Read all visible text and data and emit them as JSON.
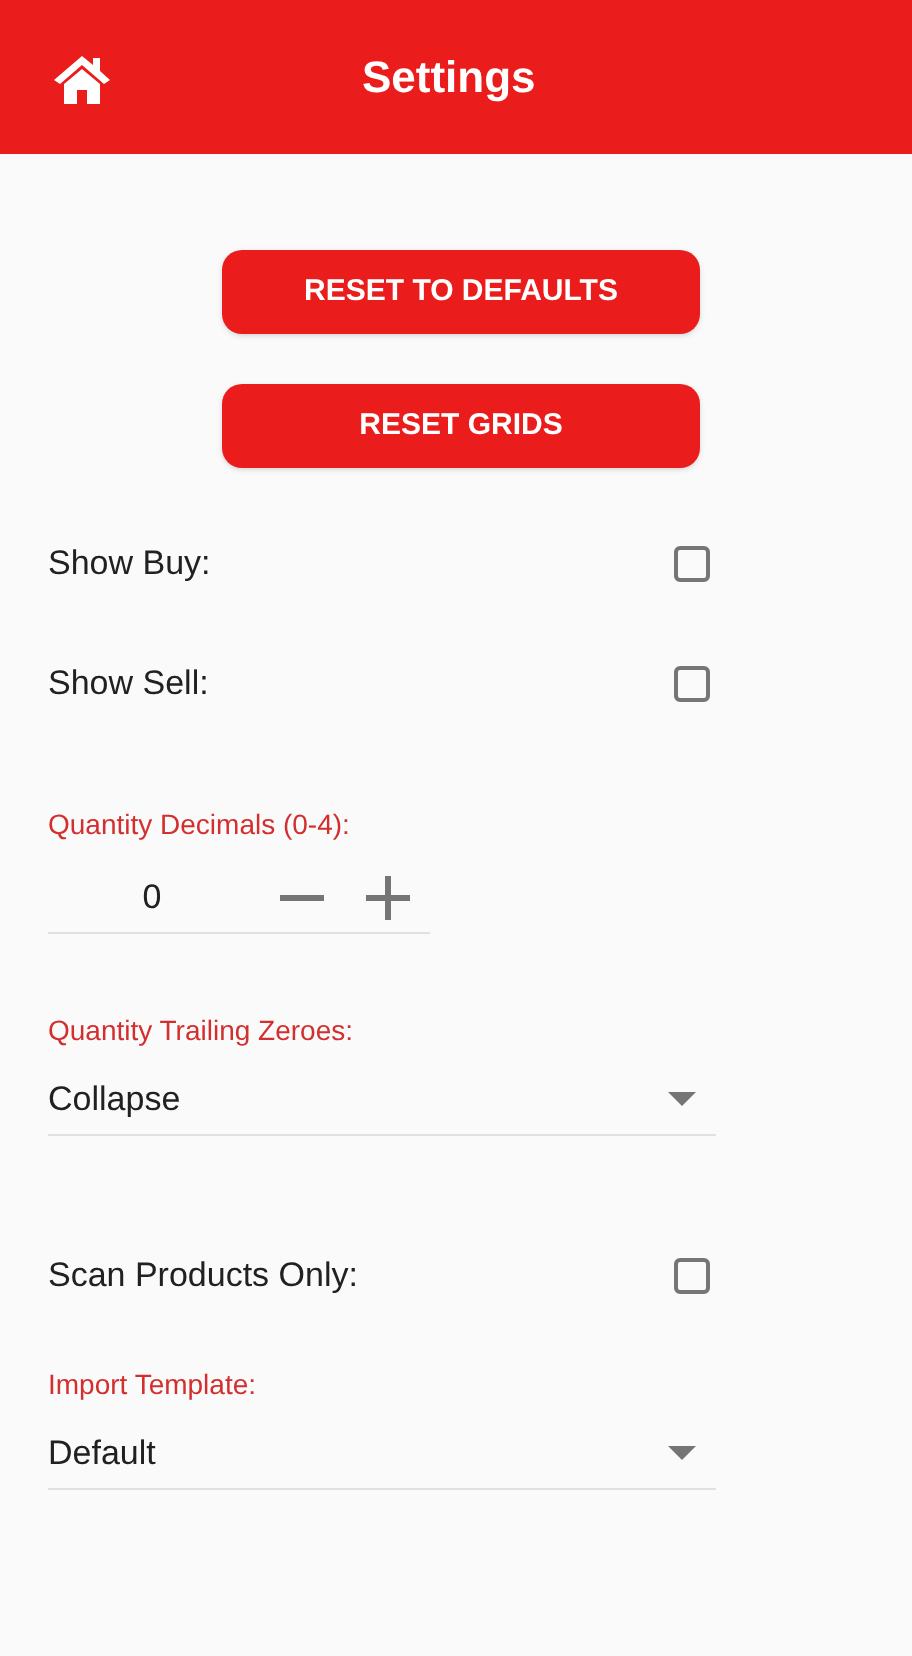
{
  "header": {
    "title": "Settings"
  },
  "buttons": [
    "RESET TO DEFAULTS",
    "RESET GRIDS"
  ],
  "settings": [
    {
      "kind": "checkbox",
      "label": "Show Buy:",
      "checked": false
    },
    {
      "kind": "checkbox",
      "label": "Show Sell:",
      "checked": false
    },
    {
      "kind": "stepper",
      "label": "Quantity Decimals (0-4):",
      "value": "0"
    },
    {
      "kind": "select",
      "label": "Quantity Trailing Zeroes:",
      "value": "Collapse"
    },
    {
      "kind": "checkbox",
      "label": "Scan Products Only:",
      "checked": false
    },
    {
      "kind": "select",
      "label": "Import Template:",
      "value": "Default"
    }
  ]
}
